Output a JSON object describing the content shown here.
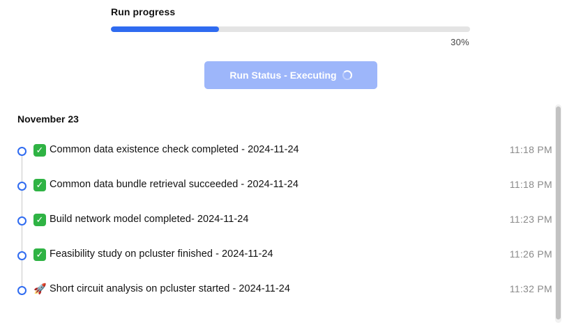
{
  "progress": {
    "title": "Run progress",
    "value_percent": 30,
    "label": "30%",
    "fill_color": "#2f6bf0"
  },
  "run_status": {
    "label": "Run Status - Executing",
    "icon": "spinner-icon",
    "color": "#9db6fa"
  },
  "timeline": {
    "date_heading": "November 23",
    "items": [
      {
        "icon": "check-mark-icon",
        "text": "Common data existence check completed - 2024-11-24",
        "time": "11:18 PM"
      },
      {
        "icon": "check-mark-icon",
        "text": "Common data bundle retrieval succeeded - 2024-11-24",
        "time": "11:18 PM"
      },
      {
        "icon": "check-mark-icon",
        "text": "Build network model completed- 2024-11-24",
        "time": "11:23 PM"
      },
      {
        "icon": "check-mark-icon",
        "text": "Feasibility study on pcluster finished - 2024-11-24",
        "time": "11:26 PM"
      },
      {
        "icon": "rocket-icon",
        "text": "Short circuit analysis on pcluster started - 2024-11-24",
        "time": "11:32 PM"
      }
    ]
  }
}
